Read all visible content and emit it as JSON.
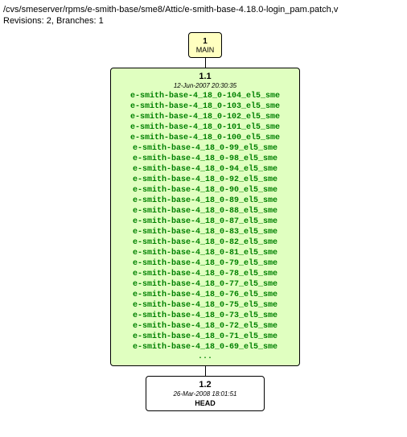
{
  "header": {
    "path": "/cvs/smeserver/rpms/e-smith-base/sme8/Attic/e-smith-base-4.18.0-login_pam.patch,v",
    "revisions": "Revisions: 2, Branches: 1"
  },
  "main_node": {
    "number": "1",
    "label": "MAIN"
  },
  "rev1": {
    "number": "1.1",
    "date": "12-Jun-2007 20:30:35",
    "tags": [
      "e-smith-base-4_18_0-104_el5_sme",
      "e-smith-base-4_18_0-103_el5_sme",
      "e-smith-base-4_18_0-102_el5_sme",
      "e-smith-base-4_18_0-101_el5_sme",
      "e-smith-base-4_18_0-100_el5_sme",
      "e-smith-base-4_18_0-99_el5_sme",
      "e-smith-base-4_18_0-98_el5_sme",
      "e-smith-base-4_18_0-94_el5_sme",
      "e-smith-base-4_18_0-92_el5_sme",
      "e-smith-base-4_18_0-90_el5_sme",
      "e-smith-base-4_18_0-89_el5_sme",
      "e-smith-base-4_18_0-88_el5_sme",
      "e-smith-base-4_18_0-87_el5_sme",
      "e-smith-base-4_18_0-83_el5_sme",
      "e-smith-base-4_18_0-82_el5_sme",
      "e-smith-base-4_18_0-81_el5_sme",
      "e-smith-base-4_18_0-79_el5_sme",
      "e-smith-base-4_18_0-78_el5_sme",
      "e-smith-base-4_18_0-77_el5_sme",
      "e-smith-base-4_18_0-76_el5_sme",
      "e-smith-base-4_18_0-75_el5_sme",
      "e-smith-base-4_18_0-73_el5_sme",
      "e-smith-base-4_18_0-72_el5_sme",
      "e-smith-base-4_18_0-71_el5_sme",
      "e-smith-base-4_18_0-69_el5_sme"
    ],
    "ellipsis": "..."
  },
  "rev2": {
    "number": "1.2",
    "date": "26-Mar-2008 18:01:51",
    "label": "HEAD"
  }
}
